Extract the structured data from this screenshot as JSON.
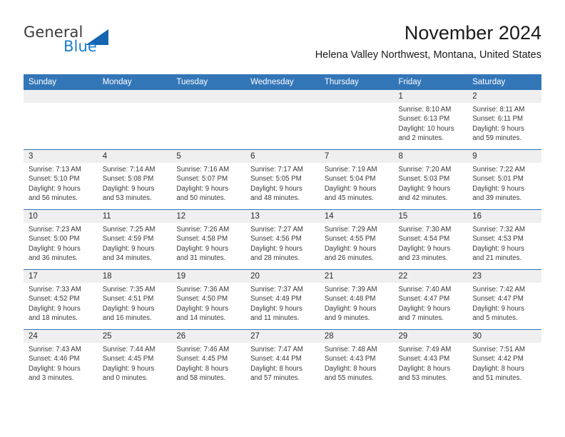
{
  "brand": {
    "name_part1": "General",
    "name_part2": "Blue",
    "logo_icon": "triangle-logo-icon",
    "accent_color": "#1565b0",
    "blue_text_color": "#1b7fce"
  },
  "header": {
    "month_title": "November 2024",
    "location": "Helena Valley Northwest, Montana, United States"
  },
  "calendar": {
    "header_bg": "#3376b8",
    "daynum_bg": "#efefef",
    "weekday_headers": [
      "Sunday",
      "Monday",
      "Tuesday",
      "Wednesday",
      "Thursday",
      "Friday",
      "Saturday"
    ],
    "weeks": [
      [
        {
          "day": "",
          "sunrise": "",
          "sunset": "",
          "daylight_line1": "",
          "daylight_line2": ""
        },
        {
          "day": "",
          "sunrise": "",
          "sunset": "",
          "daylight_line1": "",
          "daylight_line2": ""
        },
        {
          "day": "",
          "sunrise": "",
          "sunset": "",
          "daylight_line1": "",
          "daylight_line2": ""
        },
        {
          "day": "",
          "sunrise": "",
          "sunset": "",
          "daylight_line1": "",
          "daylight_line2": ""
        },
        {
          "day": "",
          "sunrise": "",
          "sunset": "",
          "daylight_line1": "",
          "daylight_line2": ""
        },
        {
          "day": "1",
          "sunrise": "Sunrise: 8:10 AM",
          "sunset": "Sunset: 6:13 PM",
          "daylight_line1": "Daylight: 10 hours",
          "daylight_line2": "and 2 minutes."
        },
        {
          "day": "2",
          "sunrise": "Sunrise: 8:11 AM",
          "sunset": "Sunset: 6:11 PM",
          "daylight_line1": "Daylight: 9 hours",
          "daylight_line2": "and 59 minutes."
        }
      ],
      [
        {
          "day": "3",
          "sunrise": "Sunrise: 7:13 AM",
          "sunset": "Sunset: 5:10 PM",
          "daylight_line1": "Daylight: 9 hours",
          "daylight_line2": "and 56 minutes."
        },
        {
          "day": "4",
          "sunrise": "Sunrise: 7:14 AM",
          "sunset": "Sunset: 5:08 PM",
          "daylight_line1": "Daylight: 9 hours",
          "daylight_line2": "and 53 minutes."
        },
        {
          "day": "5",
          "sunrise": "Sunrise: 7:16 AM",
          "sunset": "Sunset: 5:07 PM",
          "daylight_line1": "Daylight: 9 hours",
          "daylight_line2": "and 50 minutes."
        },
        {
          "day": "6",
          "sunrise": "Sunrise: 7:17 AM",
          "sunset": "Sunset: 5:05 PM",
          "daylight_line1": "Daylight: 9 hours",
          "daylight_line2": "and 48 minutes."
        },
        {
          "day": "7",
          "sunrise": "Sunrise: 7:19 AM",
          "sunset": "Sunset: 5:04 PM",
          "daylight_line1": "Daylight: 9 hours",
          "daylight_line2": "and 45 minutes."
        },
        {
          "day": "8",
          "sunrise": "Sunrise: 7:20 AM",
          "sunset": "Sunset: 5:03 PM",
          "daylight_line1": "Daylight: 9 hours",
          "daylight_line2": "and 42 minutes."
        },
        {
          "day": "9",
          "sunrise": "Sunrise: 7:22 AM",
          "sunset": "Sunset: 5:01 PM",
          "daylight_line1": "Daylight: 9 hours",
          "daylight_line2": "and 39 minutes."
        }
      ],
      [
        {
          "day": "10",
          "sunrise": "Sunrise: 7:23 AM",
          "sunset": "Sunset: 5:00 PM",
          "daylight_line1": "Daylight: 9 hours",
          "daylight_line2": "and 36 minutes."
        },
        {
          "day": "11",
          "sunrise": "Sunrise: 7:25 AM",
          "sunset": "Sunset: 4:59 PM",
          "daylight_line1": "Daylight: 9 hours",
          "daylight_line2": "and 34 minutes."
        },
        {
          "day": "12",
          "sunrise": "Sunrise: 7:26 AM",
          "sunset": "Sunset: 4:58 PM",
          "daylight_line1": "Daylight: 9 hours",
          "daylight_line2": "and 31 minutes."
        },
        {
          "day": "13",
          "sunrise": "Sunrise: 7:27 AM",
          "sunset": "Sunset: 4:56 PM",
          "daylight_line1": "Daylight: 9 hours",
          "daylight_line2": "and 28 minutes."
        },
        {
          "day": "14",
          "sunrise": "Sunrise: 7:29 AM",
          "sunset": "Sunset: 4:55 PM",
          "daylight_line1": "Daylight: 9 hours",
          "daylight_line2": "and 26 minutes."
        },
        {
          "day": "15",
          "sunrise": "Sunrise: 7:30 AM",
          "sunset": "Sunset: 4:54 PM",
          "daylight_line1": "Daylight: 9 hours",
          "daylight_line2": "and 23 minutes."
        },
        {
          "day": "16",
          "sunrise": "Sunrise: 7:32 AM",
          "sunset": "Sunset: 4:53 PM",
          "daylight_line1": "Daylight: 9 hours",
          "daylight_line2": "and 21 minutes."
        }
      ],
      [
        {
          "day": "17",
          "sunrise": "Sunrise: 7:33 AM",
          "sunset": "Sunset: 4:52 PM",
          "daylight_line1": "Daylight: 9 hours",
          "daylight_line2": "and 18 minutes."
        },
        {
          "day": "18",
          "sunrise": "Sunrise: 7:35 AM",
          "sunset": "Sunset: 4:51 PM",
          "daylight_line1": "Daylight: 9 hours",
          "daylight_line2": "and 16 minutes."
        },
        {
          "day": "19",
          "sunrise": "Sunrise: 7:36 AM",
          "sunset": "Sunset: 4:50 PM",
          "daylight_line1": "Daylight: 9 hours",
          "daylight_line2": "and 14 minutes."
        },
        {
          "day": "20",
          "sunrise": "Sunrise: 7:37 AM",
          "sunset": "Sunset: 4:49 PM",
          "daylight_line1": "Daylight: 9 hours",
          "daylight_line2": "and 11 minutes."
        },
        {
          "day": "21",
          "sunrise": "Sunrise: 7:39 AM",
          "sunset": "Sunset: 4:48 PM",
          "daylight_line1": "Daylight: 9 hours",
          "daylight_line2": "and 9 minutes."
        },
        {
          "day": "22",
          "sunrise": "Sunrise: 7:40 AM",
          "sunset": "Sunset: 4:47 PM",
          "daylight_line1": "Daylight: 9 hours",
          "daylight_line2": "and 7 minutes."
        },
        {
          "day": "23",
          "sunrise": "Sunrise: 7:42 AM",
          "sunset": "Sunset: 4:47 PM",
          "daylight_line1": "Daylight: 9 hours",
          "daylight_line2": "and 5 minutes."
        }
      ],
      [
        {
          "day": "24",
          "sunrise": "Sunrise: 7:43 AM",
          "sunset": "Sunset: 4:46 PM",
          "daylight_line1": "Daylight: 9 hours",
          "daylight_line2": "and 3 minutes."
        },
        {
          "day": "25",
          "sunrise": "Sunrise: 7:44 AM",
          "sunset": "Sunset: 4:45 PM",
          "daylight_line1": "Daylight: 9 hours",
          "daylight_line2": "and 0 minutes."
        },
        {
          "day": "26",
          "sunrise": "Sunrise: 7:46 AM",
          "sunset": "Sunset: 4:45 PM",
          "daylight_line1": "Daylight: 8 hours",
          "daylight_line2": "and 58 minutes."
        },
        {
          "day": "27",
          "sunrise": "Sunrise: 7:47 AM",
          "sunset": "Sunset: 4:44 PM",
          "daylight_line1": "Daylight: 8 hours",
          "daylight_line2": "and 57 minutes."
        },
        {
          "day": "28",
          "sunrise": "Sunrise: 7:48 AM",
          "sunset": "Sunset: 4:43 PM",
          "daylight_line1": "Daylight: 8 hours",
          "daylight_line2": "and 55 minutes."
        },
        {
          "day": "29",
          "sunrise": "Sunrise: 7:49 AM",
          "sunset": "Sunset: 4:43 PM",
          "daylight_line1": "Daylight: 8 hours",
          "daylight_line2": "and 53 minutes."
        },
        {
          "day": "30",
          "sunrise": "Sunrise: 7:51 AM",
          "sunset": "Sunset: 4:42 PM",
          "daylight_line1": "Daylight: 8 hours",
          "daylight_line2": "and 51 minutes."
        }
      ]
    ]
  }
}
